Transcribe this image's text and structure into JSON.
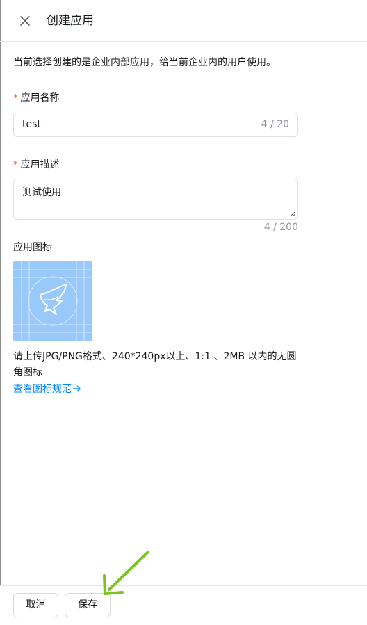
{
  "header": {
    "title": "创建应用",
    "close_icon": "close-icon"
  },
  "notice": "当前选择创建的是企业内部应用，给当前企业内的用户使用。",
  "form": {
    "name": {
      "required_mark": "*",
      "label": "应用名称",
      "value": "test",
      "counter": "4 / 20"
    },
    "description": {
      "required_mark": "*",
      "label": "应用描述",
      "value": "测试使用",
      "counter": "4 / 200"
    },
    "icon": {
      "label": "应用图标",
      "preview_icon": "dingtalk-logo-icon",
      "preview_color": "#99c8fb"
    }
  },
  "hint_text": "请上传JPG/PNG格式、240*240px以上、1:1 、2MB 以内的无圆角图标",
  "spec_link": {
    "label": "查看图标规范",
    "icon": "arrow-right-icon",
    "color": "#0089ff"
  },
  "footer": {
    "cancel_label": "取消",
    "save_label": "保存"
  },
  "annotation": {
    "icon": "green-arrow-icon",
    "color": "#7cc41f"
  },
  "colors": {
    "required": "#ff5219",
    "counter": "#8f959e",
    "border": "#dcdfe3"
  }
}
